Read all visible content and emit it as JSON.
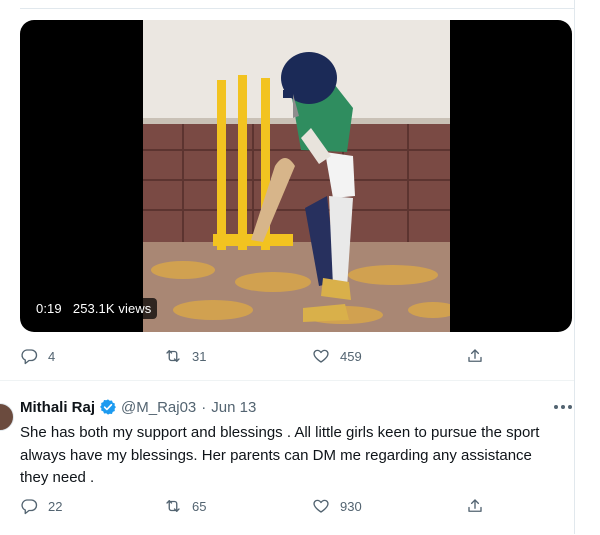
{
  "video": {
    "time": "0:19",
    "views": "253.1K views"
  },
  "top_actions": {
    "replies": "4",
    "retweets": "31",
    "likes": "459"
  },
  "tweet": {
    "name": "Mithali Raj",
    "handle": "@M_Raj03",
    "separator": "·",
    "date": "Jun 13",
    "text": "She has both my support and blessings . All little girls keen to pursue the sport always have my blessings.  Her parents can DM me regarding any assistance they need ."
  },
  "bottom_actions": {
    "replies": "22",
    "retweets": "65",
    "likes": "930"
  },
  "colors": {
    "verified": "#1d9bf0",
    "muted": "#536471",
    "text": "#0f1419"
  }
}
